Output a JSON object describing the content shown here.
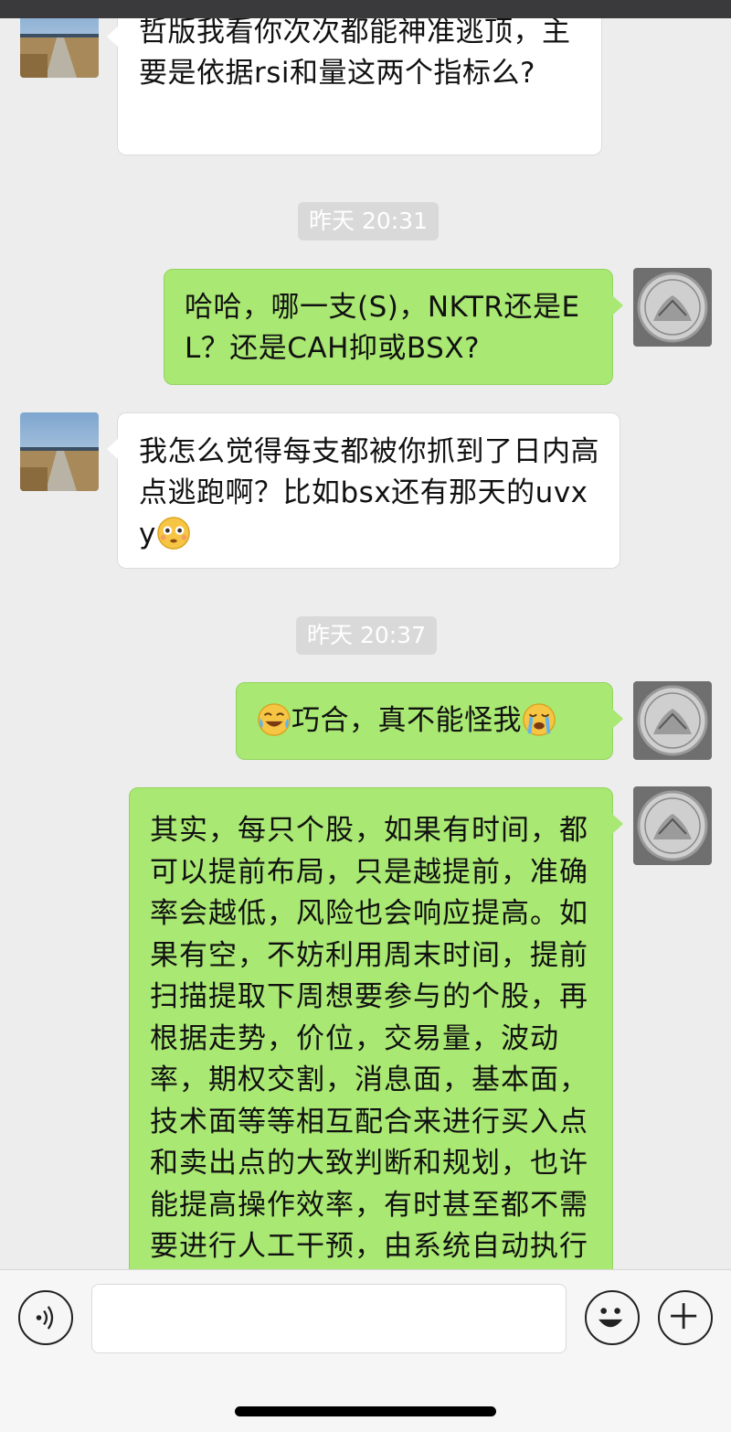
{
  "messages": [
    {
      "side": "left",
      "avatar": "landscape-avatar",
      "text": "哲版我看你次次都能神准逃顶，主要是依据rsi和量这两个指标么?"
    },
    {
      "type": "time",
      "text": "昨天 20:31"
    },
    {
      "side": "right",
      "avatar": "coin-avatar",
      "text": "哈哈，哪一支(S)，NKTR还是EL？还是CAH抑或BSX?"
    },
    {
      "side": "left",
      "avatar": "landscape-avatar",
      "text": "我怎么觉得每支都被你抓到了日内高点逃跑啊？比如bsx还有那天的uvxy",
      "trailing_emoji": "flushed-face"
    },
    {
      "type": "time",
      "text": "昨天 20:37"
    },
    {
      "side": "right",
      "avatar": "coin-avatar",
      "leading_emoji": "tears-of-joy",
      "text": "巧合，真不能怪我",
      "trailing_emoji": "loudly-crying"
    },
    {
      "side": "right",
      "avatar": "coin-avatar",
      "text": "其实，每只个股，如果有时间，都可以提前布局，只是越提前，准确率会越低，风险也会响应提高。如果有空，不妨利用周末时间，提前扫描提取下周想要参与的个股，再根据走势，价位，交易量，波动率，期权交割，消息面，基本面，技术面等等相互配合来进行买入点和卖出点的大致判断和规划，也许能提高操作效率，有时甚至都不需要进行人工干预，由系统自动执行交易。^"
    }
  ],
  "input_bar": {
    "voice_icon": "voice-icon",
    "emoji_icon": "emoji-icon",
    "add_icon": "plus-icon",
    "placeholder": ""
  },
  "colors": {
    "background": "#ededed",
    "left_bubble": "#ffffff",
    "right_bubble": "#a9e872",
    "time_badge": "#d9d9d9"
  }
}
